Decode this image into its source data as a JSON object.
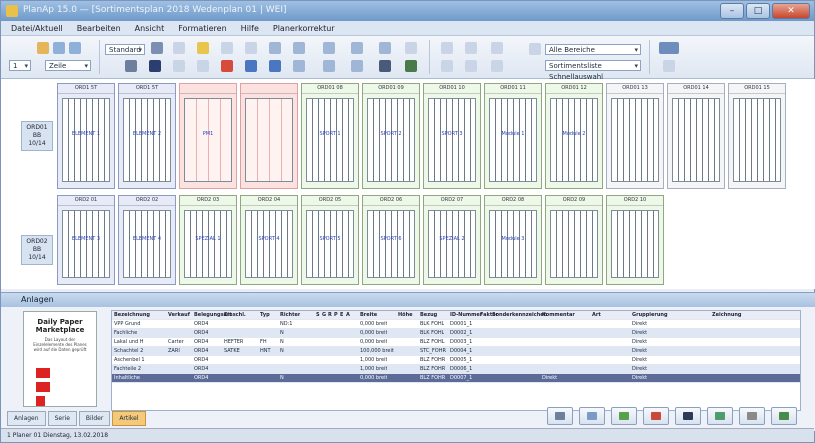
{
  "window": {
    "title": "PlanAp 15.0 — [Sortimentsplan 2018 Wedenplan 01 | WEI]"
  },
  "menu": [
    "Datei/Aktuell",
    "Bearbeiten",
    "Ansicht",
    "Formatieren",
    "Hilfe",
    "Planerkorrektur"
  ],
  "toolbar": {
    "layout_combo": "Standard",
    "zoom_combo": "Zeile",
    "sort_combo_1": "Alle Bereiche",
    "sort_combo_2": "Sortimentsliste Schnellauswahl"
  },
  "plan": {
    "row_labels": [
      {
        "line1": "ORD01",
        "line2": "BB",
        "line3": "10/14"
      },
      {
        "line1": "ORD02",
        "line2": "BB",
        "line3": "10/14"
      }
    ],
    "row1": [
      {
        "header": "ORD1 5T",
        "label": "ELEMENT 1",
        "kind": "blue"
      },
      {
        "header": "ORD1 5T",
        "label": "ELEMENT 2",
        "kind": "blue"
      },
      {
        "header": "",
        "label": "PM1",
        "kind": "pink"
      },
      {
        "header": "",
        "label": "",
        "kind": "pink"
      },
      {
        "header": "ORD01 08",
        "label": "SPORT 1",
        "kind": "green"
      },
      {
        "header": "ORD01 09",
        "label": "SPORT 2",
        "kind": "green"
      },
      {
        "header": "ORD01 10",
        "label": "SPORT 3",
        "kind": "green"
      },
      {
        "header": "ORD01 11",
        "label": "Module 1",
        "kind": "green"
      },
      {
        "header": "ORD01 12",
        "label": "Module 2",
        "kind": "green"
      },
      {
        "header": "ORD01 13",
        "label": "",
        "kind": "grey"
      },
      {
        "header": "ORD01 14",
        "label": "",
        "kind": "grey"
      },
      {
        "header": "ORD01 15",
        "label": "",
        "kind": "grey"
      }
    ],
    "row2": [
      {
        "header": "ORD2 01",
        "label": "ELEMENT 3",
        "kind": "blue"
      },
      {
        "header": "ORD2 02",
        "label": "ELEMENT 4",
        "kind": "blue"
      },
      {
        "header": "ORD2 03",
        "label": "SPEZIAL 1",
        "kind": "green"
      },
      {
        "header": "ORD2 04",
        "label": "SPORT 4",
        "kind": "green"
      },
      {
        "header": "ORD2 05",
        "label": "SPORT 5",
        "kind": "green"
      },
      {
        "header": "ORD2 06",
        "label": "SPORT 6",
        "kind": "green"
      },
      {
        "header": "ORD2 07",
        "label": "SPEZIAL 2",
        "kind": "green"
      },
      {
        "header": "ORD2 08",
        "label": "Module 3",
        "kind": "green"
      },
      {
        "header": "ORD2 09",
        "label": "",
        "kind": "green"
      },
      {
        "header": "ORD2 10",
        "label": "",
        "kind": "green"
      }
    ]
  },
  "panel": {
    "title": "Anlagen",
    "thumb_title": "Daily Paper Marketplace",
    "thumb_text": "Das Layout der Einzelelemente des Planes wird auf die Daten geprüft",
    "columns": [
      "Bezeichnung",
      "Verkauf",
      "Belegungsart",
      "Einschl.",
      "Typ",
      "Richter",
      "S",
      "G",
      "R",
      "P",
      "E",
      "A",
      "Breite",
      "Höhe",
      "Bezug",
      "ID-Nummer",
      "Faktor",
      "Sonderkennzeichen",
      "Kommentar",
      "Art",
      "Gruppierung",
      "Zeichnung"
    ],
    "rows": [
      [
        "VPP Grund",
        "",
        "ORD4",
        "",
        "",
        "ND:1",
        "",
        "",
        "",
        "",
        "",
        "",
        "0,000 breit",
        "",
        "BLK FOHL",
        "D0001_1",
        "",
        "",
        "",
        "",
        "Direkt",
        ""
      ],
      [
        "Fachliche",
        "",
        "ORD4",
        "",
        "",
        "N",
        "",
        "",
        "",
        "",
        "",
        "",
        "0,000 breit",
        "",
        "BLK FOHL",
        "D0002_1",
        "",
        "",
        "",
        "",
        "Direkt",
        ""
      ],
      [
        "Lakal und H",
        "Carter",
        "ORD4",
        "HEFTER",
        "FH",
        "N",
        "",
        "",
        "",
        "",
        "",
        "",
        "0,000 breit",
        "",
        "BLZ FOHL",
        "D0003_1",
        "",
        "",
        "",
        "",
        "Direkt",
        ""
      ],
      [
        "Schachtel 2",
        "ZARI",
        "ORD4",
        "SATKE",
        "HNT",
        "N",
        "",
        "",
        "",
        "",
        "",
        "",
        "100,000 breit",
        "",
        "STC_FOHR",
        "D0004_1",
        "",
        "",
        "",
        "",
        "Direkt",
        ""
      ],
      [
        "Aschenbel 1",
        "",
        "ORD4",
        "",
        "",
        "",
        "",
        "",
        "",
        "",
        "",
        "",
        "1,000 breit",
        "",
        "BLZ FOHR",
        "D0005_1",
        "",
        "",
        "",
        "",
        "Direkt",
        ""
      ],
      [
        "Fachteile 2",
        "",
        "ORD4",
        "",
        "",
        "",
        "",
        "",
        "",
        "",
        "",
        "",
        "1,000 breit",
        "",
        "BLZ FOHR",
        "D0006_1",
        "",
        "",
        "",
        "",
        "Direkt",
        ""
      ],
      [
        "Inhaltliche",
        "",
        "ORD4",
        "",
        "",
        "N",
        "",
        "",
        "",
        "",
        "",
        "",
        "0,000 breit",
        "",
        "BLZ FOHR",
        "D0007_1",
        "",
        "",
        "Direkt",
        "",
        "Direkt",
        ""
      ]
    ],
    "selected_row": 6
  },
  "tabs": [
    "Anlagen",
    "Serie",
    "Bilder",
    "Artikel"
  ],
  "status": {
    "text": "1  Planer 01  Dienstag, 13.02.2018"
  }
}
